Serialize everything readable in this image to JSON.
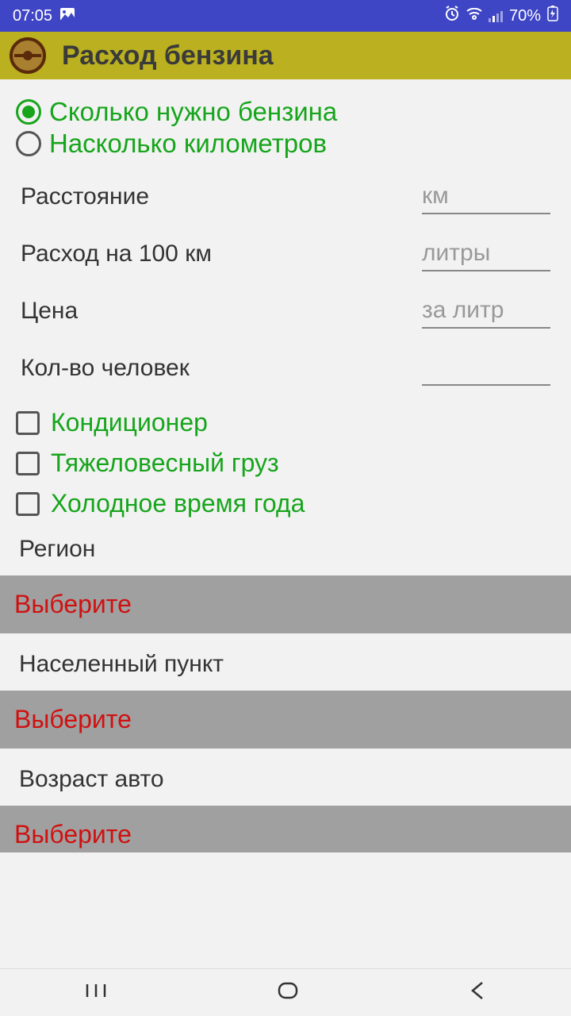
{
  "status": {
    "time": "07:05",
    "battery": "70%"
  },
  "app": {
    "title": "Расход бензина"
  },
  "radios": {
    "option1": "Сколько нужно бензина",
    "option2": "Насколько километров"
  },
  "form": {
    "distance_label": "Расстояние",
    "distance_placeholder": "км",
    "consumption_label": "Расход на 100 км",
    "consumption_placeholder": "литры",
    "price_label": "Цена",
    "price_placeholder": "за литр",
    "people_label": "Кол-во человек",
    "people_placeholder": ""
  },
  "checkboxes": {
    "ac": "Кондиционер",
    "heavy": "Тяжеловесный груз",
    "cold": "Холодное время года"
  },
  "sections": {
    "region_label": "Регион",
    "region_select": "Выберите",
    "city_label": "Населенный пункт",
    "city_select": "Выберите",
    "age_label": "Возраст авто",
    "age_select": "Выберите"
  }
}
